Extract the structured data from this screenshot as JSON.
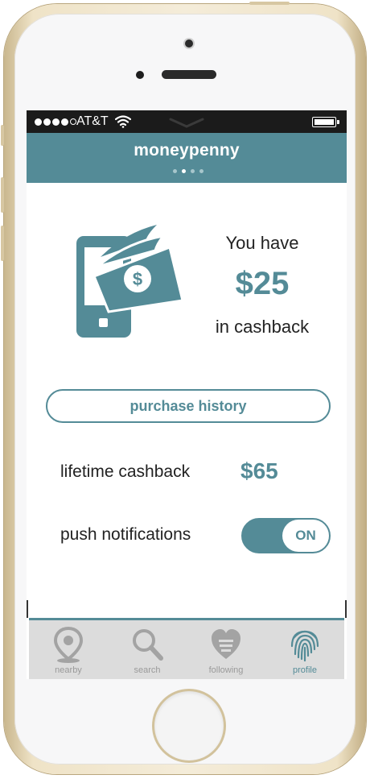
{
  "status_bar": {
    "carrier": "AT&T"
  },
  "header": {
    "title": "moneypenny",
    "page_count": 4,
    "active_page": 2
  },
  "hero": {
    "you_have": "You have",
    "amount": "$25",
    "suffix": "in cashback",
    "icon": "phone-money-icon"
  },
  "purchase_history_label": "purchase history",
  "lifetime": {
    "label": "lifetime cashback",
    "value": "$65"
  },
  "push": {
    "label": "push notifications",
    "state": "ON"
  },
  "tabs": [
    {
      "label": "nearby",
      "icon": "location-pin-icon",
      "active": false
    },
    {
      "label": "search",
      "icon": "magnifier-icon",
      "active": false
    },
    {
      "label": "following",
      "icon": "heart-icon",
      "active": false
    },
    {
      "label": "profile",
      "icon": "fingerprint-icon",
      "active": true
    }
  ],
  "colors": {
    "accent": "#548b97",
    "tab_inactive": "#9a9a9a",
    "tab_bg": "#dcdcdc"
  }
}
